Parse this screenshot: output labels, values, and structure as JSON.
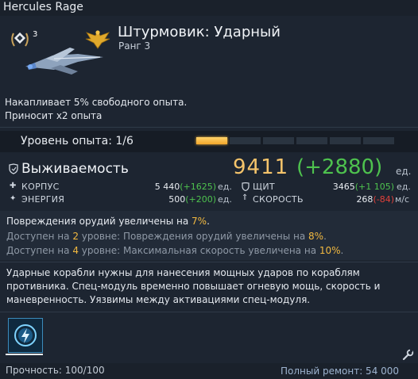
{
  "window": {
    "title": "Hercules Rage"
  },
  "ship": {
    "name": "Штурмовик: Ударный",
    "rank_label": "Ранг 3",
    "rank_badge_number": "3",
    "bonus_lines": [
      "Накапливает 5% свободного опыта.",
      "Приносит x2 опыта"
    ]
  },
  "experience": {
    "label": "Уровень опыта: 1/6",
    "level": 1,
    "max_level": 6
  },
  "survivability": {
    "title": "Выживаемость",
    "total": "9411",
    "bonus": "(+2880)",
    "unit": "ед.",
    "stats": {
      "hull": {
        "label": "КОРПУС",
        "value": "5 440",
        "bonus": "(+1625)",
        "unit": "ед."
      },
      "energy": {
        "label": "ЭНЕРГИЯ",
        "value": "500",
        "bonus": "(+200)",
        "unit": "ед."
      },
      "shield": {
        "label": "ЩИТ",
        "value": "3465",
        "bonus": "(+1 105)",
        "unit": "ед."
      },
      "speed": {
        "label": "СКОРОСТЬ",
        "value": "268",
        "bonus": "(-84)",
        "unit": "м/с"
      }
    }
  },
  "modules": {
    "current": {
      "text": "Повреждения орудий увеличены на ",
      "value": "7%",
      "tail": "."
    },
    "level2": {
      "prefix": "Доступен на ",
      "level": "2",
      "middle": " уровне: Повреждения орудий увеличены на ",
      "value": "8%",
      "tail": "."
    },
    "level4": {
      "prefix": "Доступен на ",
      "level": "4",
      "middle": " уровне: Максимальная скорость увеличена на ",
      "value": "10%",
      "tail": "."
    }
  },
  "description": "Ударные корабли нужны для нанесения мощных ударов по кораблям противника. Спец-модуль временно повышает огневую мощь, скорость и маневренность. Уязвимы между активациями спец-модуля.",
  "ability": {
    "icon": "lightning-shield-icon"
  },
  "footer": {
    "durability": "Прочность: 100/100",
    "repair": "Полный ремонт: 54 000"
  },
  "colors": {
    "background": "#1d2531",
    "accent_gold": "#f5c46b",
    "bonus_green": "#4ec24e",
    "penalty_red": "#e0403a",
    "xp_fill": "#f3a72b"
  }
}
